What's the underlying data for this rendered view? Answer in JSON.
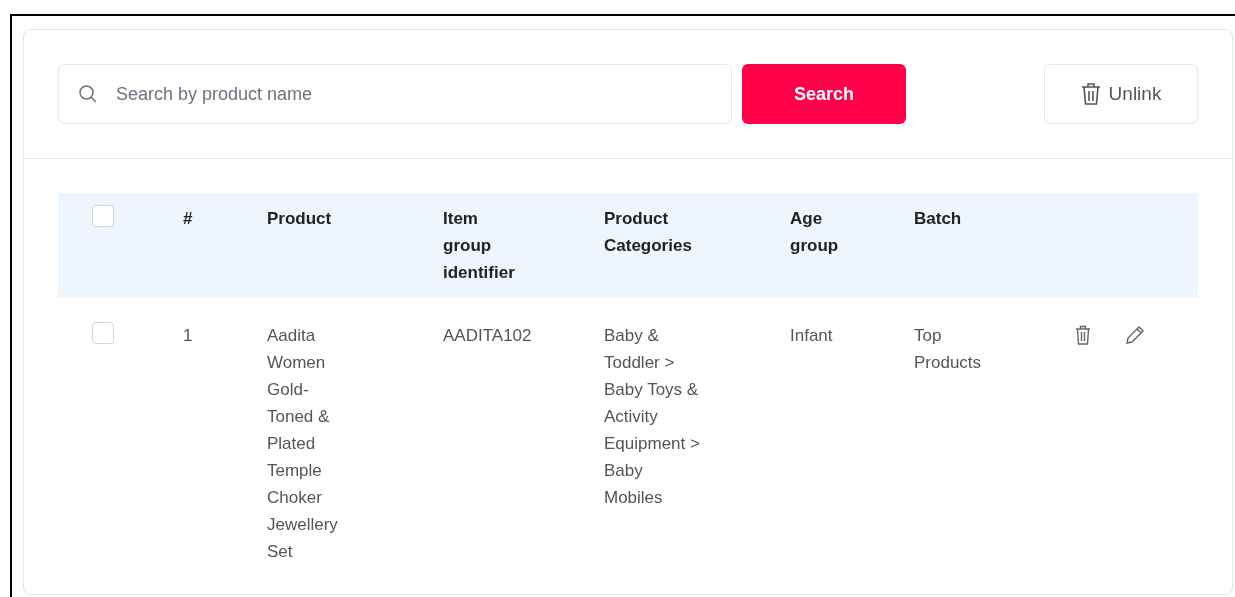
{
  "search": {
    "placeholder": "Search by product name",
    "button": "Search"
  },
  "unlink_button": "Unlink",
  "table": {
    "select_all": {
      "checked": false
    },
    "columns": [
      "#",
      "Product",
      "Item group identifier",
      "Product Categories",
      "Age group",
      "Batch"
    ],
    "rows": [
      {
        "checked": false,
        "cells": [
          "1",
          "Aadita Women Gold-Toned & Plated Temple Choker Jewellery Set",
          "AADITA102",
          "Baby & Toddler > Baby Toys & Activity Equipment > Baby Mobiles",
          "Infant",
          "Top Products"
        ]
      }
    ]
  }
}
